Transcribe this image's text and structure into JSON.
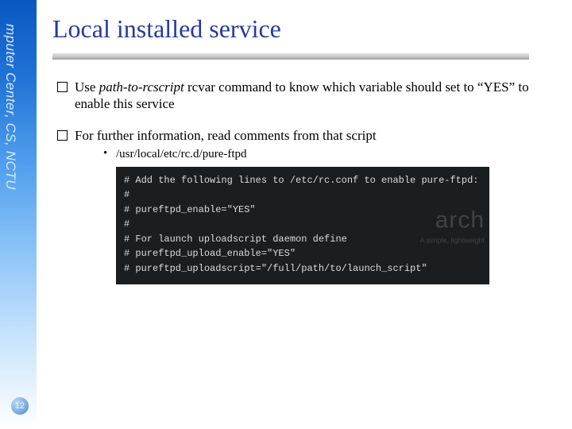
{
  "page": {
    "number": "12"
  },
  "sidebar": {
    "label": "mputer Center, CS, NCTU"
  },
  "title": "Local installed service",
  "bullets": {
    "b1": {
      "pre": "Use ",
      "ital": "path-to-rcscript",
      "post": " rcvar command to know which variable should set to “YES” to enable this service"
    },
    "b2": {
      "text": "For further information, read comments from that script"
    },
    "b2a": {
      "text": "/usr/local/etc/rc.d/pure-ftpd"
    }
  },
  "terminal": {
    "lines": "# Add the following lines to /etc/rc.conf to enable pure-ftpd:\n#\n# pureftpd_enable=\"YES\"\n#\n# For launch uploadscript daemon define\n# pureftpd_upload_enable=\"YES\"\n# pureftpd_uploadscript=\"/full/path/to/launch_script\"",
    "watermark_brand": "arch",
    "watermark_tag": "A simple, lightweight"
  }
}
